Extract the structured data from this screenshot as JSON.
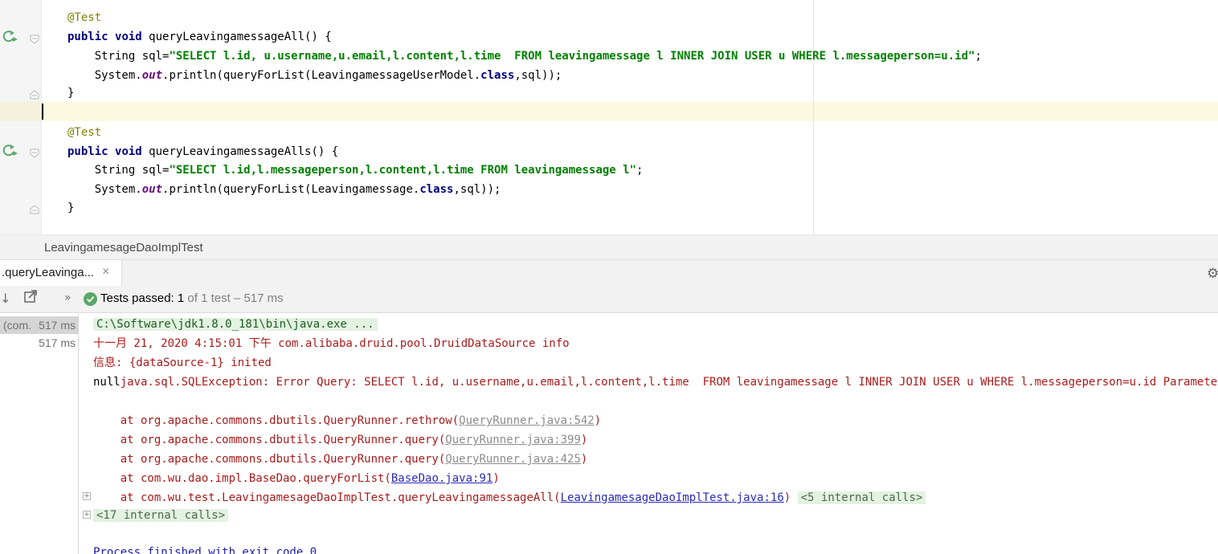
{
  "editor": {
    "method1": {
      "annotation": "@Test",
      "kw_public": "public",
      "kw_void": "void",
      "signature": " queryLeavingamessageAll() {",
      "line_sql_prefix": "    String sql=",
      "line_sql_string": "\"SELECT l.id, u.username,u.email,l.content,l.time  FROM leavingamessage l INNER JOIN USER u WHERE l.messageperson=u.id\"",
      "line_sql_suffix": ";",
      "println_prefix": "    System.",
      "println_out": "out",
      "println_mid": ".println(queryForList(LeavingamessageUserModel.",
      "println_class": "class",
      "println_end": ",sql));",
      "close_brace": "}"
    },
    "method2": {
      "annotation": "@Test",
      "kw_public": "public",
      "kw_void": "void",
      "signature": " queryLeavingamessageAlls() {",
      "line_sql_prefix": "    String sql=",
      "line_sql_string": "\"SELECT l.id,l.messageperson,l.content,l.time FROM leavingamessage l\"",
      "line_sql_suffix": ";",
      "println_prefix": "    System.",
      "println_out": "out",
      "println_mid": ".println(queryForList(Leavingamessage.",
      "println_class": "class",
      "println_end": ",sql));",
      "close_brace": "}"
    }
  },
  "breadcrumb": "LeavingamesageDaoImplTest",
  "run_panel": {
    "tab_label": ".queryLeavinga...",
    "tab_close": "×",
    "status_label": "Tests passed: ",
    "status_count": "1",
    "status_detail": " of 1 test – 517 ms",
    "tree": {
      "row1_name": "(com.",
      "row1_time": "517 ms",
      "row2_time": "517 ms"
    }
  },
  "console": {
    "cmd": "C:\\Software\\jdk1.8.0_181\\bin\\java.exe ...",
    "log1": "十一月 21, 2020 4:15:01 下午 com.alibaba.druid.pool.DruidDataSource info",
    "log2": "信息: {dataSource-1} inited",
    "null_prefix": "null",
    "exception": "java.sql.SQLException: Error Query: SELECT l.id, u.username,u.email,l.content,l.time  FROM leavingamessage l INNER JOIN USER u WHERE l.messageperson=u.id Parameters: []",
    "trace": [
      {
        "text": "    at org.apache.commons.dbutils.QueryRunner.rethrow(",
        "link": "QueryRunner.java:542",
        "end": ")"
      },
      {
        "text": "    at org.apache.commons.dbutils.QueryRunner.query(",
        "link": "QueryRunner.java:399",
        "end": ")"
      },
      {
        "text": "    at org.apache.commons.dbutils.QueryRunner.query(",
        "link": "QueryRunner.java:425",
        "end": ")"
      },
      {
        "text": "    at com.wu.dao.impl.BaseDao.queryForList(",
        "link": "BaseDao.java:91",
        "end": ")"
      },
      {
        "text": "    at com.wu.test.LeavingamesageDaoImplTest.queryLeavingamessageAll(",
        "link": "LeavingamesageDaoImplTest.java:16",
        "end": ")",
        "internal": "<5 internal calls>"
      }
    ],
    "internal_calls": "<17 internal calls>",
    "finished": "Process finished with exit code 0"
  },
  "colors": {
    "string": "#008000",
    "keyword": "#000080",
    "annotation": "#808000",
    "error": "#aa1b1b",
    "pass": "#59a869"
  }
}
